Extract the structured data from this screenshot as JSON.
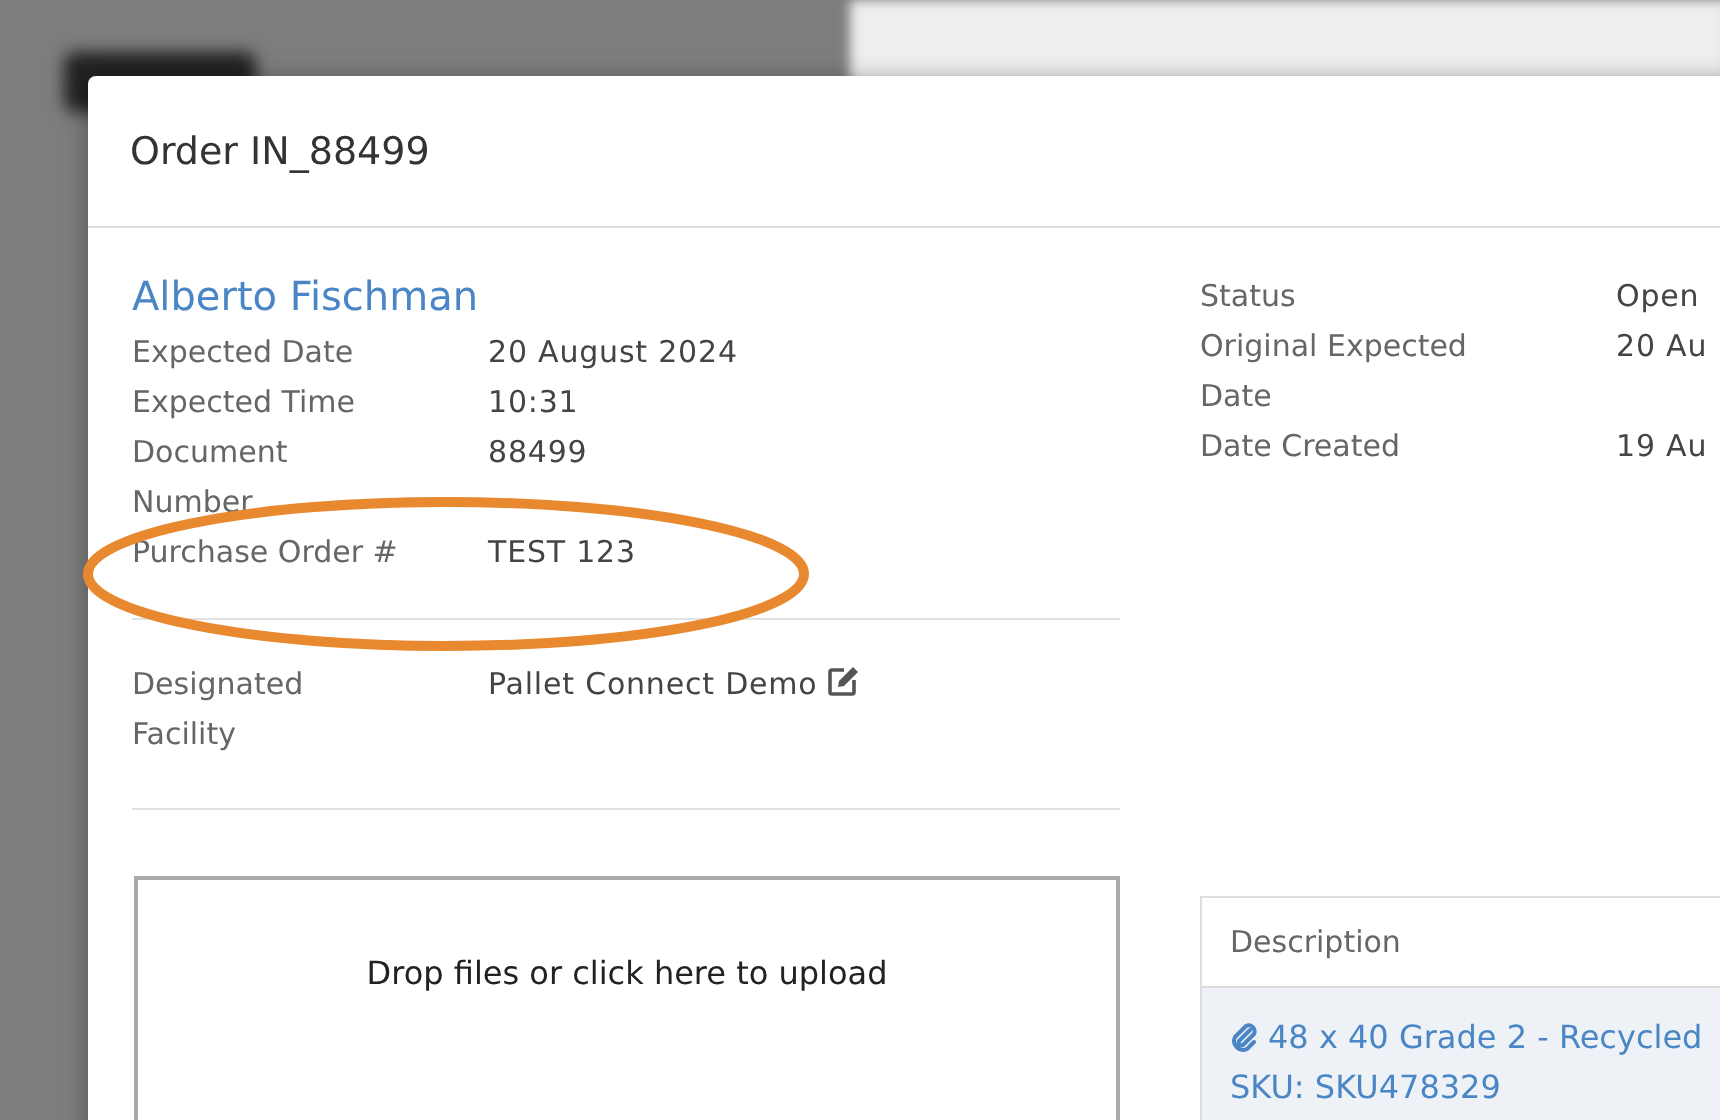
{
  "modal": {
    "title": "Order IN_88499"
  },
  "customer": {
    "name": "Alberto Fischman"
  },
  "details": [
    {
      "label": "Expected Date",
      "value": "20 August 2024"
    },
    {
      "label": "Expected Time",
      "value": "10:31"
    },
    {
      "label": "Document\nNumber",
      "value": "88499"
    },
    {
      "label": "Purchase Order #",
      "value": "TEST 123"
    }
  ],
  "facility": {
    "label": "Designated\nFacility",
    "value": "Pallet Connect Demo"
  },
  "status_details": [
    {
      "label": "Status",
      "value": "Open"
    },
    {
      "label": "Original Expected\nDate",
      "value": "20 Au"
    },
    {
      "label": "Date Created",
      "value": "19 Au"
    }
  ],
  "upload": {
    "text": "Drop files or click here to upload"
  },
  "items_table": {
    "columns": [
      "Description"
    ],
    "rows": [
      {
        "description": "48 x 40 Grade 2 - Recycled",
        "sku": "SKU: SKU478329"
      }
    ]
  }
}
